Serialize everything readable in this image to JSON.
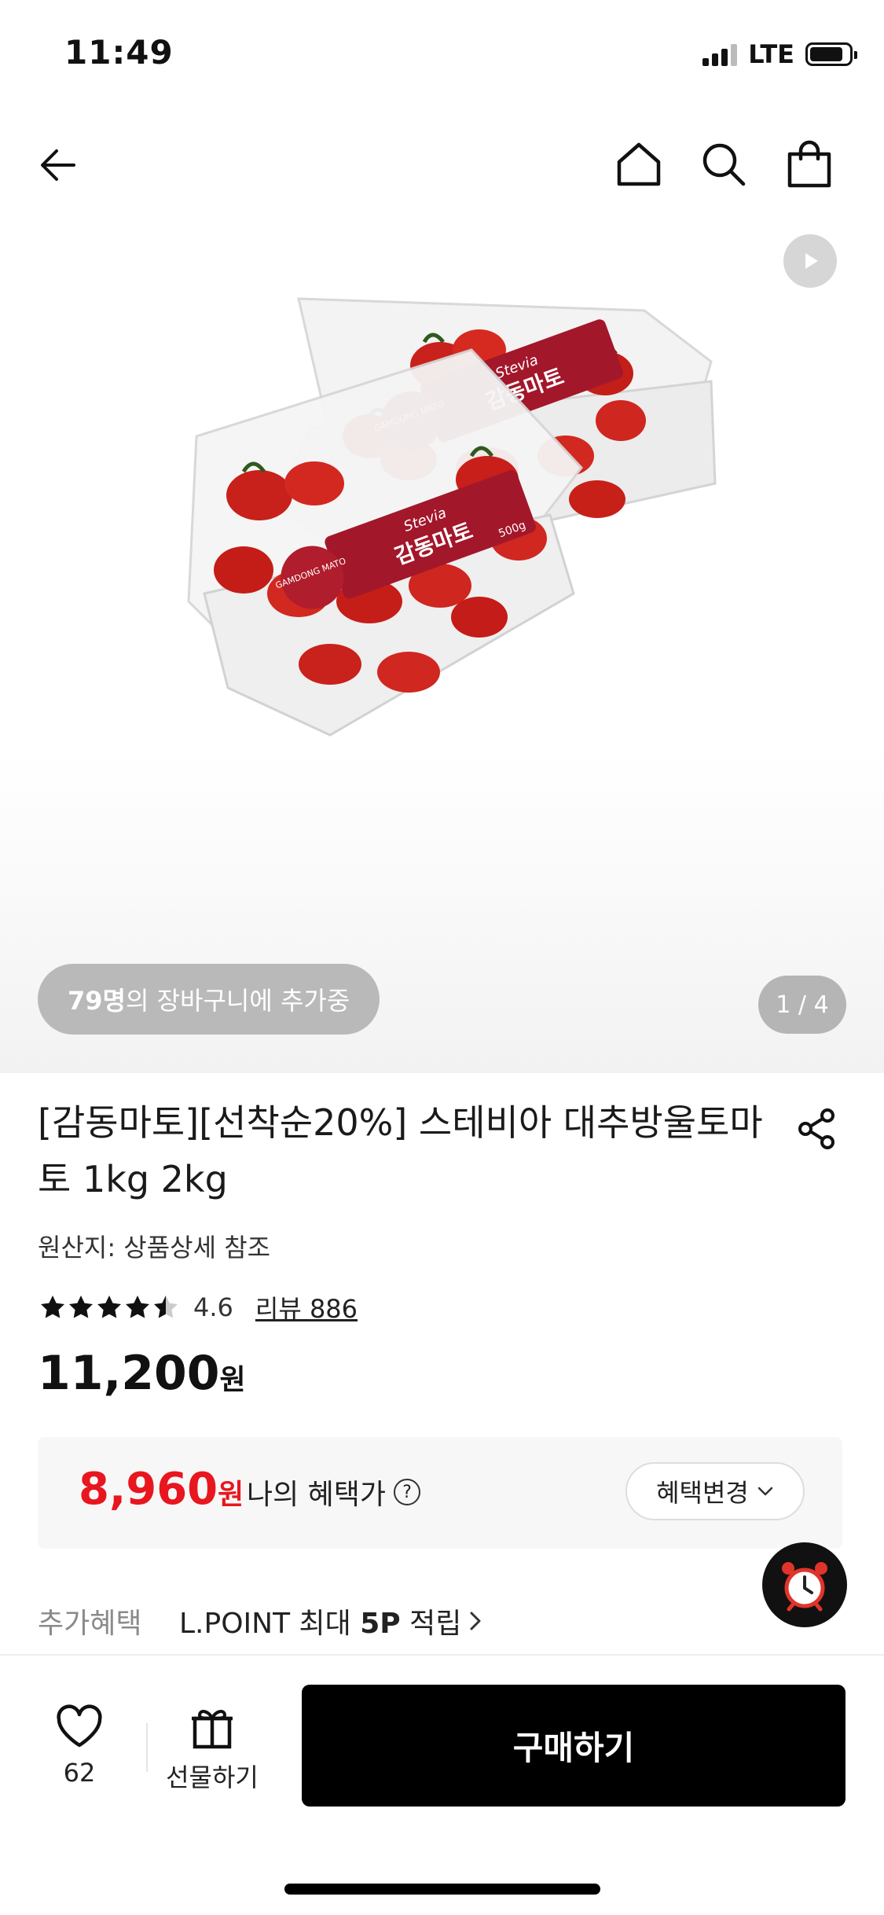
{
  "status_bar": {
    "time": "11:49",
    "network": "LTE",
    "battery_percent": 85
  },
  "nav": {
    "back_icon": "arrow-left-icon",
    "home_icon": "home-icon",
    "search_icon": "search-icon",
    "cart_icon": "shopping-bag-icon"
  },
  "hero": {
    "cart_count": "79명",
    "cart_text": "의 장바구니에 추가중",
    "pager": "1 / 4",
    "package_labels": [
      "GAMDONG MATO",
      "Stevia",
      "감동마토",
      "500g"
    ]
  },
  "product": {
    "title": "[감동마토][선착순20%] 스테비아 대추방울토마토 1kg 2kg",
    "origin": "원산지: 상품상세 참조",
    "rating": "4.6",
    "rating_value": 4.6,
    "review": "리뷰 886",
    "price": "11,200",
    "price_unit": "원"
  },
  "benefit": {
    "price": "8,960",
    "price_unit": "원",
    "label": "나의 혜택가",
    "help": "?",
    "change_button": "혜택변경"
  },
  "extra": {
    "label": "추가혜택",
    "value_prefix": "L.POINT 최대 ",
    "value_bold": "5P",
    "value_suffix": " 적립"
  },
  "bottom_bar": {
    "like_count": "62",
    "gift_label": "선물하기",
    "buy_label": "구매하기"
  },
  "colors": {
    "sale_red": "#e8161f",
    "buy_button": "#000000",
    "pill_gray": "#b9b9b9"
  }
}
